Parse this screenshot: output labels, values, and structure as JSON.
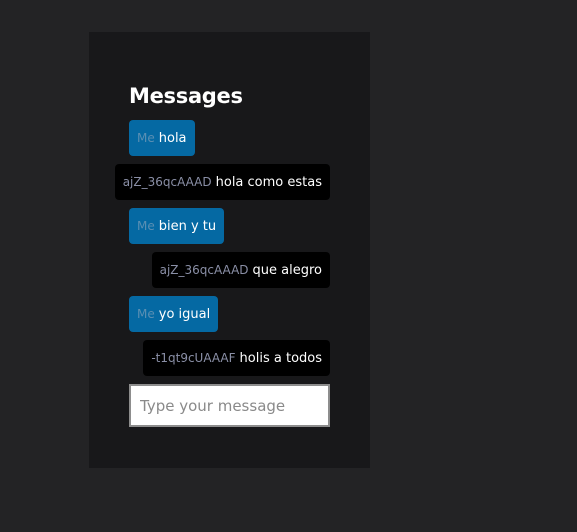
{
  "chat": {
    "title": "Messages",
    "messages": [
      {
        "sender": "Me",
        "text": "hola",
        "mine": true
      },
      {
        "sender": "ajZ_36qcAAAD",
        "text": "hola como estas",
        "mine": false
      },
      {
        "sender": "Me",
        "text": "bien y tu",
        "mine": true
      },
      {
        "sender": "ajZ_36qcAAAD",
        "text": "que alegro",
        "mine": false
      },
      {
        "sender": "Me",
        "text": "yo igual",
        "mine": true
      },
      {
        "sender": "-t1qt9cUAAAF",
        "text": "holis a todos",
        "mine": false
      }
    ],
    "input": {
      "value": "",
      "placeholder": "Type your message"
    }
  },
  "colors": {
    "background": "#232325",
    "panel": "#18181a",
    "my_bubble": "#0569a3",
    "other_bubble": "#000000"
  }
}
